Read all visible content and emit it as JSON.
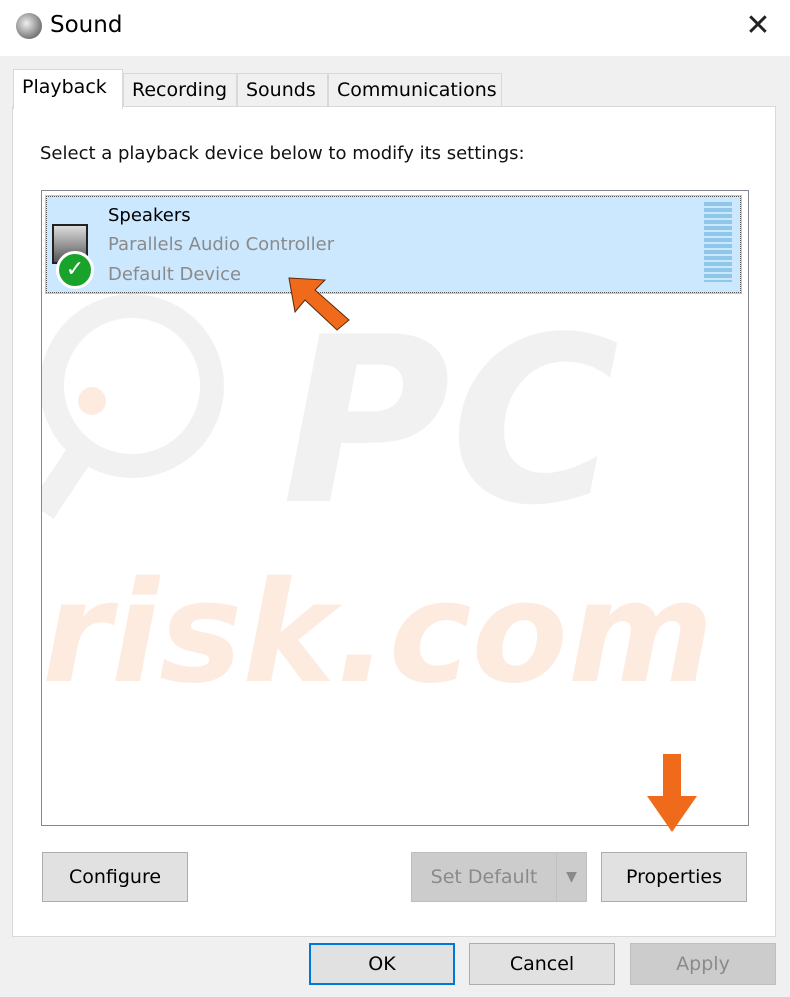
{
  "window": {
    "title": "Sound",
    "close_icon": "close-icon"
  },
  "tabs": [
    {
      "label": "Playback",
      "active": true
    },
    {
      "label": "Recording"
    },
    {
      "label": "Sounds"
    },
    {
      "label": "Communications"
    }
  ],
  "instruction": "Select a playback device below to modify its settings:",
  "devices": [
    {
      "name": "Speakers",
      "driver": "Parallels Audio Controller",
      "status": "Default Device",
      "selected": true,
      "icon": "speaker-icon",
      "badge": "check-icon"
    }
  ],
  "watermark": "PC risk.com",
  "buttons": {
    "configure": "Configure",
    "set_default": "Set Default",
    "properties": "Properties",
    "ok": "OK",
    "cancel": "Cancel",
    "apply": "Apply"
  },
  "colors": {
    "accent": "#0078d7",
    "selection": "#cce8ff",
    "arrow": "#f06a1c",
    "check": "#1aa32a"
  }
}
